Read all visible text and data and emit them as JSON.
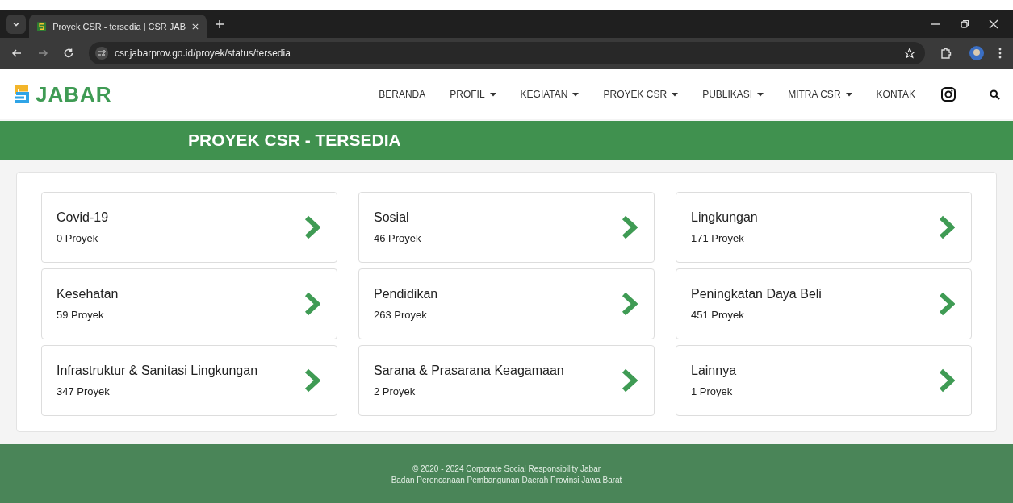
{
  "browser": {
    "tab_title": "Proyek CSR - tersedia | CSR JAB",
    "url": "csr.jabarprov.go.id/proyek/status/tersedia"
  },
  "site": {
    "logo_text": "JABAR"
  },
  "nav": [
    {
      "label": "BERANDA",
      "dropdown": false
    },
    {
      "label": "PROFIL",
      "dropdown": true
    },
    {
      "label": "KEGIATAN",
      "dropdown": true
    },
    {
      "label": "PROYEK CSR",
      "dropdown": true
    },
    {
      "label": "PUBLIKASI",
      "dropdown": true
    },
    {
      "label": "MITRA CSR",
      "dropdown": true
    },
    {
      "label": "KONTAK",
      "dropdown": false
    }
  ],
  "banner": {
    "title": "PROYEK CSR - TERSEDIA"
  },
  "categories": [
    {
      "name": "Covid-19",
      "count": "0 Proyek"
    },
    {
      "name": "Sosial",
      "count": "46 Proyek"
    },
    {
      "name": "Lingkungan",
      "count": "171 Proyek"
    },
    {
      "name": "Kesehatan",
      "count": "59 Proyek"
    },
    {
      "name": "Pendidikan",
      "count": "263 Proyek"
    },
    {
      "name": "Peningkatan Daya Beli",
      "count": "451 Proyek"
    },
    {
      "name": "Infrastruktur & Sanitasi Lingkungan",
      "count": "347 Proyek"
    },
    {
      "name": "Sarana & Prasarana Keagamaan",
      "count": "2 Proyek"
    },
    {
      "name": "Lainnya",
      "count": "1 Proyek"
    }
  ],
  "footer": {
    "copyright": "© 2020 - 2024 Corporate Social Responsibility Jabar",
    "agency": "Badan Perencanaan Pembangunan Daerah Provinsi Jawa Barat"
  }
}
